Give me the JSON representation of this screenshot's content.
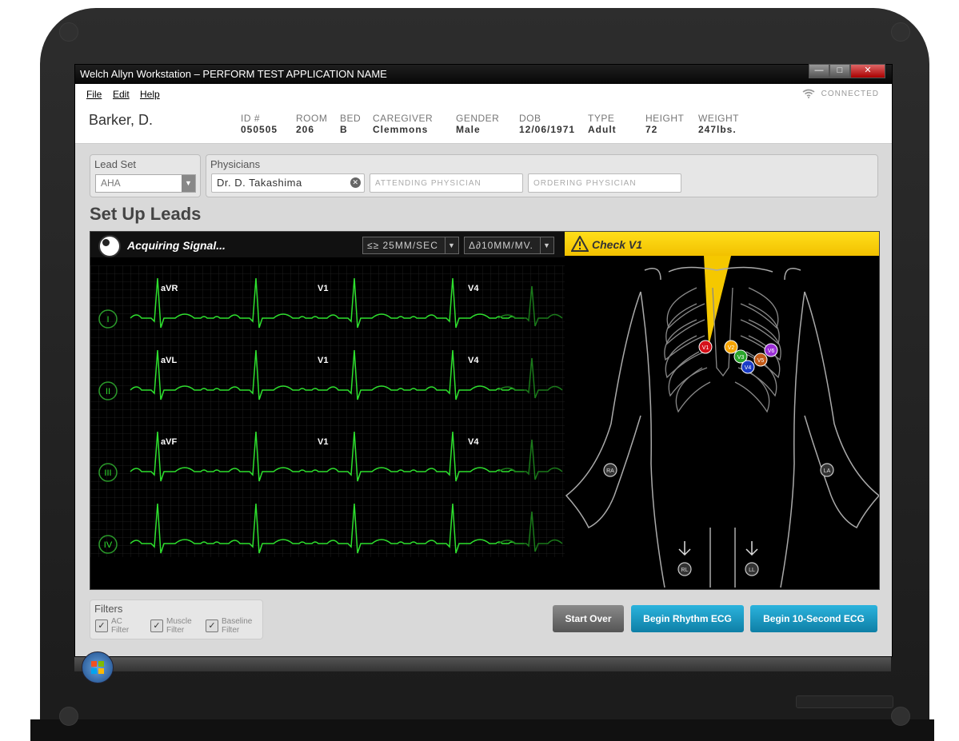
{
  "window": {
    "title": "Welch Allyn Workstation – PERFORM TEST APPLICATION NAME"
  },
  "menu": {
    "file": "File",
    "edit": "Edit",
    "help": "Help",
    "status": "CONNECTED"
  },
  "patient": {
    "name": "Barker, D.",
    "fields": [
      {
        "label": "ID #",
        "value": "050505"
      },
      {
        "label": "ROOM",
        "value": "206"
      },
      {
        "label": "BED",
        "value": "B"
      },
      {
        "label": "CAREGIVER",
        "value": "Clemmons"
      },
      {
        "label": "GENDER",
        "value": "Male"
      },
      {
        "label": "DOB",
        "value": "12/06/1971"
      },
      {
        "label": "TYPE",
        "value": "Adult"
      },
      {
        "label": "HEIGHT",
        "value": "72"
      },
      {
        "label": "WEIGHT",
        "value": "247lbs."
      }
    ]
  },
  "lead_set": {
    "label": "Lead Set",
    "value": "AHA"
  },
  "physicians": {
    "label": "Physicians",
    "value": "Dr. D. Takashima",
    "attending_placeholder": "ATTENDING PHYSICIAN",
    "ordering_placeholder": "ORDERING PHYSICIAN"
  },
  "heading": "Set Up Leads",
  "ecg": {
    "status": "Acquiring Signal...",
    "speed": "≤≥ 25MM/SEC",
    "gain": "Δ∂10MM/MV.",
    "alert": "Check V1",
    "rows": [
      {
        "lead": "I",
        "labels": [
          "aVR",
          "V1",
          "V4"
        ]
      },
      {
        "lead": "II",
        "labels": [
          "aVL",
          "V1",
          "V4"
        ]
      },
      {
        "lead": "III",
        "labels": [
          "aVF",
          "V1",
          "V4"
        ]
      },
      {
        "lead": "IV",
        "labels": []
      }
    ]
  },
  "body_leads": {
    "chest": [
      "V1",
      "V2",
      "V3",
      "V4",
      "V5",
      "V6"
    ],
    "limbs": [
      "RA",
      "LA",
      "RL",
      "LL"
    ]
  },
  "filters": {
    "label": "Filters",
    "items": [
      {
        "line1": "AC",
        "line2": "Filter"
      },
      {
        "line1": "Muscle",
        "line2": "Filter"
      },
      {
        "line1": "Baseline",
        "line2": "Filter"
      }
    ]
  },
  "buttons": {
    "start_over": "Start Over",
    "rhythm": "Begin Rhythm ECG",
    "ten_second": "Begin 10-Second ECG"
  },
  "colors": {
    "trace": "#2ee02e",
    "alert": "#ffd700",
    "accent": "#1a9fc7",
    "V1": "#d4111a",
    "V2": "#f5a300",
    "V3": "#2aa52a",
    "V4": "#1a3cc7",
    "V5": "#c25a17",
    "V6": "#9b30d6"
  }
}
